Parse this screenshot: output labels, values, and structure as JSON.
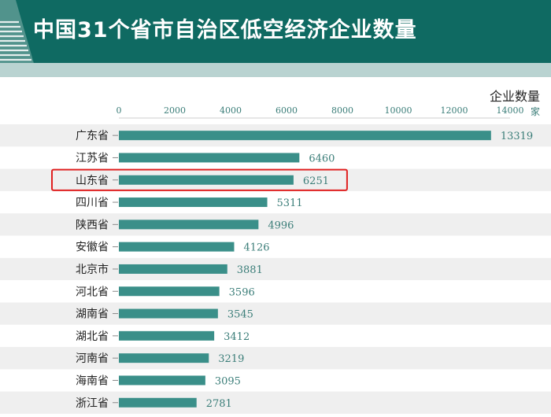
{
  "title": "中国31个省市自治区低空经济企业数量",
  "colors": {
    "header_bg": "#0f6a62",
    "band": "#b9d3d1",
    "bar": "#3a8f89",
    "stripe": "#efefef",
    "highlight": "#e02020",
    "value_text": "#3a7d78"
  },
  "chart_data": {
    "type": "bar",
    "orientation": "horizontal",
    "unit_title": "企业数量",
    "unit": "家",
    "xlim": [
      0,
      14000
    ],
    "xticks": [
      0,
      2000,
      4000,
      6000,
      8000,
      10000,
      12000,
      14000
    ],
    "categories": [
      "广东省",
      "江苏省",
      "山东省",
      "四川省",
      "陕西省",
      "安徽省",
      "北京市",
      "河北省",
      "湖南省",
      "湖北省",
      "河南省",
      "海南省",
      "浙江省"
    ],
    "values": [
      13319,
      6460,
      6251,
      5311,
      4996,
      4126,
      3881,
      3596,
      3545,
      3412,
      3219,
      3095,
      2781
    ],
    "highlighted": "山东省",
    "grid": false
  }
}
